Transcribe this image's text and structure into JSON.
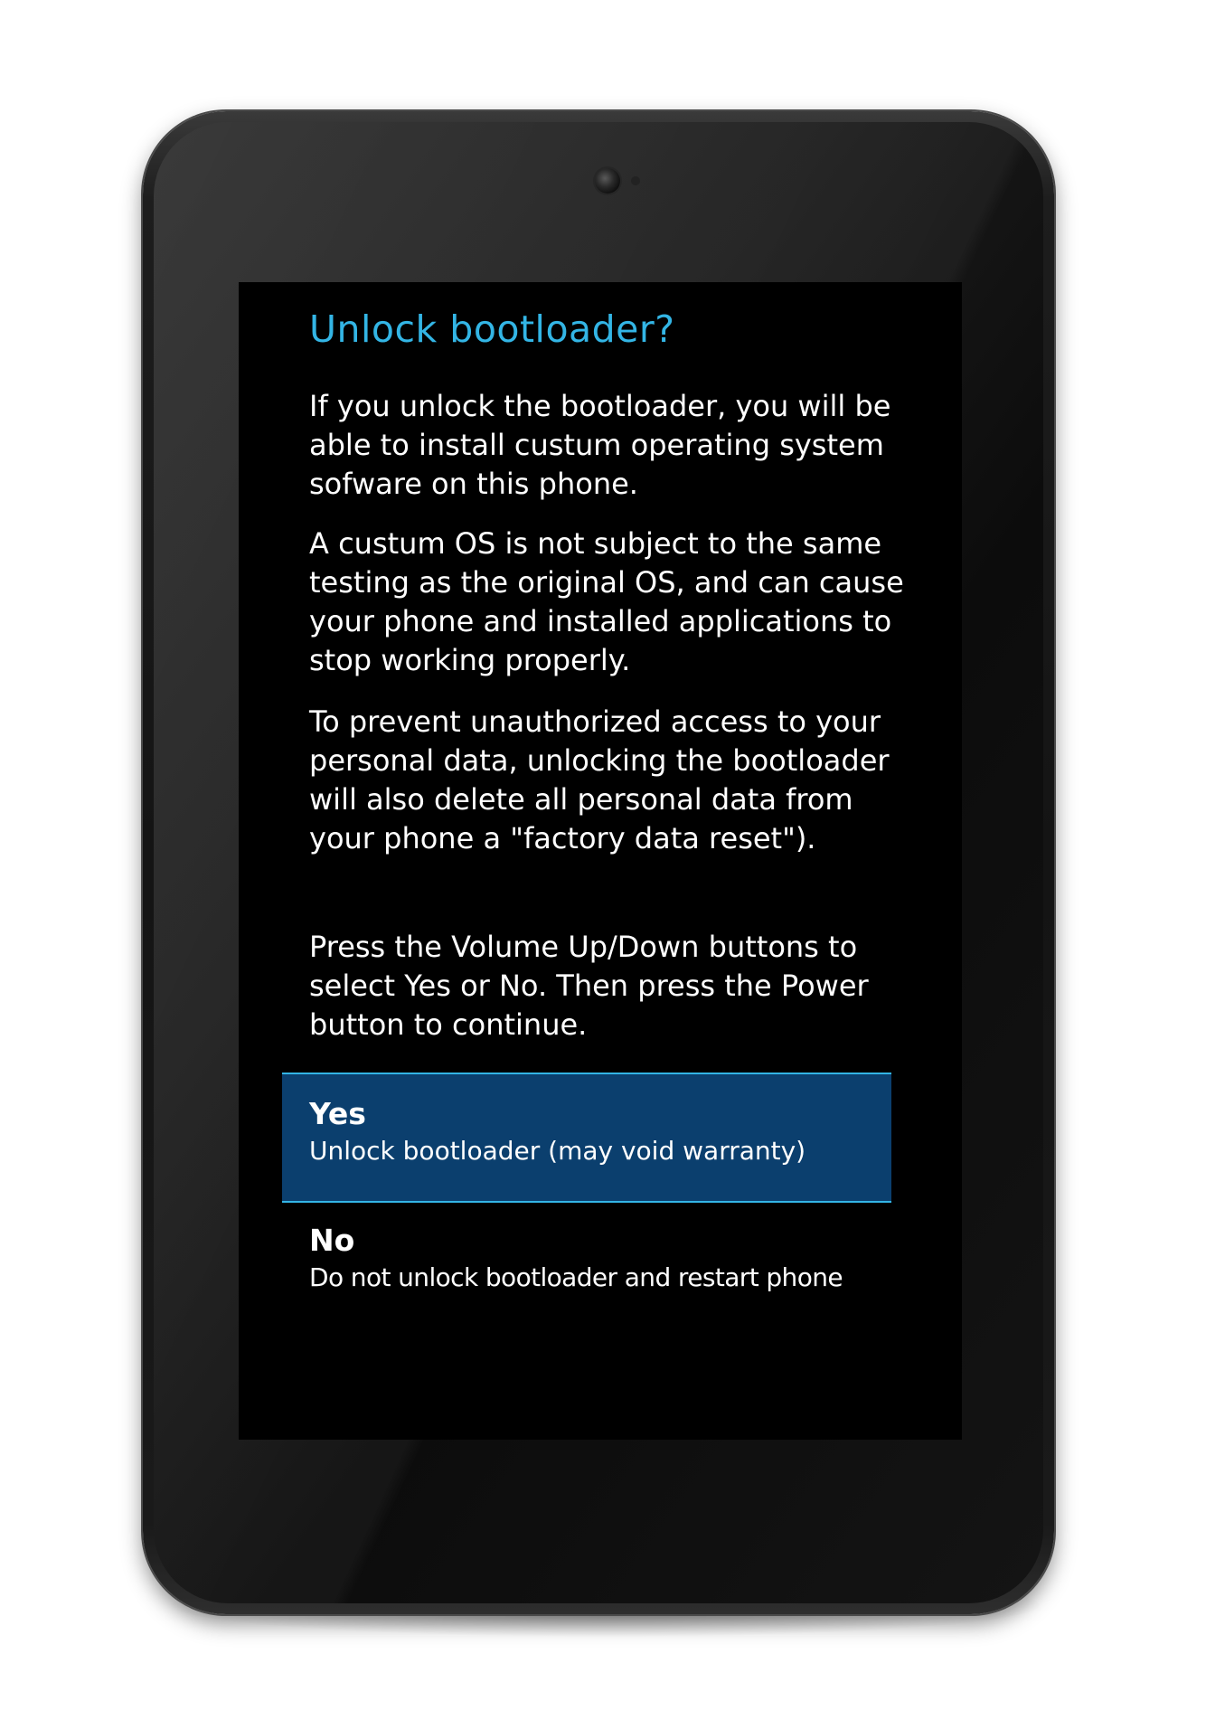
{
  "dialog": {
    "title": "Unlock bootloader?",
    "paragraphs": [
      "If you unlock the bootloader, you will be able to install custum operating system sofware on this phone.",
      "A custum OS is not subject to the same testing as the original OS, and can cause your phone and installed applications to stop working properly.",
      "To prevent unauthorized access to your personal data, unlocking the bootloader will also delete all personal data from your phone a \"factory data reset\").",
      "Press the Volume Up/Down buttons to select Yes or No. Then press the Power button to continue."
    ],
    "options": [
      {
        "label": "Yes",
        "description": "Unlock bootloader (may void warranty)",
        "selected": true
      },
      {
        "label": "No",
        "description": "Do not unlock bootloader and restart phone",
        "selected": false
      }
    ]
  },
  "colors": {
    "title": "#33b5e5",
    "selection_background": "#0b3f6e",
    "selection_border": "#33b5e5",
    "screen_background": "#000000",
    "text": "#ffffff"
  },
  "icons": {
    "front_camera": "camera-lens-icon"
  }
}
